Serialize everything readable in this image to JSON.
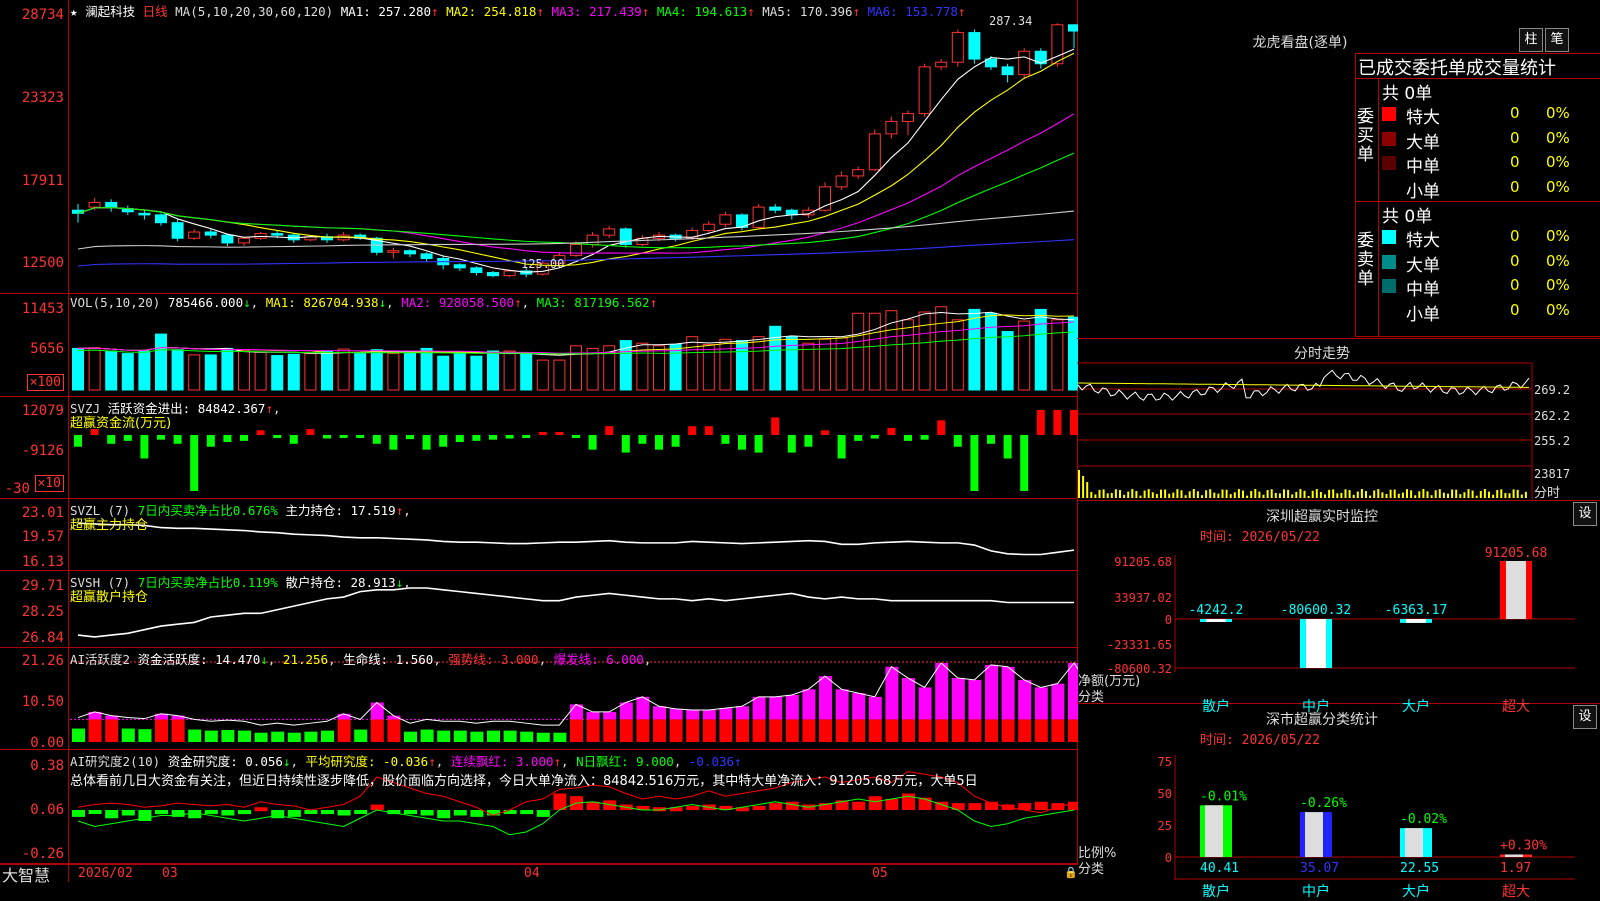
{
  "stock": {
    "name": "澜起科技",
    "period": "日线"
  },
  "kline": {
    "header": {
      "ma_params": "MA(5,10,20,30,60,120)",
      "ma1": "MA1: 257.280",
      "ma2": "MA2: 254.818",
      "ma3": "MA3: 217.439",
      "ma4": "MA4: 194.613",
      "ma5": "MA5: 170.396",
      "ma6": "MA6: 153.778"
    },
    "yaxis": [
      "28734",
      "23323",
      "17911",
      "12500"
    ],
    "high_mark": "287.34",
    "low_mark": "125.00",
    "candles": [
      [
        168,
        166,
        172,
        160
      ],
      [
        170,
        173,
        176,
        168
      ],
      [
        173,
        170,
        175,
        167
      ],
      [
        169,
        167,
        171,
        165
      ],
      [
        166,
        165,
        168,
        162
      ],
      [
        165,
        160,
        166,
        158
      ],
      [
        160,
        150,
        162,
        148
      ],
      [
        150,
        154,
        156,
        149
      ],
      [
        154,
        152,
        156,
        150
      ],
      [
        152,
        147,
        153,
        145
      ],
      [
        147,
        150,
        151,
        145
      ],
      [
        150,
        153,
        154,
        149
      ],
      [
        153,
        152,
        155,
        150
      ],
      [
        152,
        149,
        153,
        147
      ],
      [
        149,
        151,
        152,
        148
      ],
      [
        151,
        149,
        153,
        147
      ],
      [
        149,
        152,
        154,
        148
      ],
      [
        152,
        150,
        153,
        149
      ],
      [
        150,
        141,
        151,
        139
      ],
      [
        141,
        142,
        144,
        137
      ],
      [
        142,
        140,
        143,
        138
      ],
      [
        140,
        137,
        141,
        135
      ],
      [
        137,
        133,
        139,
        130
      ],
      [
        133,
        131,
        134,
        129
      ],
      [
        131,
        128,
        132,
        126
      ],
      [
        128,
        126,
        129,
        125
      ],
      [
        126,
        129,
        130,
        125
      ],
      [
        129,
        127,
        131,
        125
      ],
      [
        127,
        134,
        136,
        126
      ],
      [
        134,
        139,
        141,
        132
      ],
      [
        139,
        146,
        148,
        138
      ],
      [
        146,
        152,
        154,
        144
      ],
      [
        152,
        156,
        158,
        150
      ],
      [
        156,
        146,
        157,
        144
      ],
      [
        146,
        150,
        152,
        145
      ],
      [
        150,
        152,
        154,
        148
      ],
      [
        152,
        150,
        153,
        148
      ],
      [
        150,
        155,
        157,
        149
      ],
      [
        155,
        159,
        161,
        153
      ],
      [
        159,
        165,
        167,
        157
      ],
      [
        165,
        157,
        166,
        155
      ],
      [
        157,
        170,
        172,
        156
      ],
      [
        170,
        168,
        172,
        166
      ],
      [
        168,
        165,
        169,
        162
      ],
      [
        165,
        168,
        170,
        163
      ],
      [
        168,
        183,
        186,
        167
      ],
      [
        183,
        190,
        193,
        181
      ],
      [
        190,
        194,
        196,
        188
      ],
      [
        194,
        217,
        220,
        193
      ],
      [
        217,
        225,
        228,
        214
      ],
      [
        225,
        230,
        232,
        216
      ],
      [
        230,
        260,
        262,
        228
      ],
      [
        260,
        263,
        265,
        258
      ],
      [
        263,
        282,
        284,
        260
      ],
      [
        282,
        265,
        284,
        262
      ],
      [
        265,
        260,
        267,
        258
      ],
      [
        260,
        255,
        262,
        250
      ],
      [
        255,
        270,
        272,
        252
      ],
      [
        270,
        262,
        272,
        259
      ],
      [
        262,
        287,
        288,
        260
      ],
      [
        287,
        283,
        287,
        272
      ]
    ]
  },
  "vol": {
    "header": {
      "params": "VOL(5,10,20)",
      "value": "785466.000",
      "ma1": "MA1: 826704.938",
      "ma2": "MA2: 928058.500",
      "ma3": "MA3: 817196.562"
    },
    "yaxis": [
      "11453",
      "5656",
      "×100"
    ],
    "values": [
      640,
      650,
      600,
      560,
      600,
      860,
      620,
      540,
      540,
      640,
      610,
      580,
      530,
      550,
      560,
      600,
      630,
      560,
      620,
      560,
      600,
      640,
      520,
      560,
      520,
      600,
      600,
      550,
      460,
      460,
      680,
      640,
      680,
      760,
      720,
      680,
      700,
      820,
      700,
      780,
      760,
      820,
      980,
      820,
      720,
      780,
      800,
      1180,
      1180,
      1220,
      1080,
      1200,
      1280,
      1080,
      1240,
      1180,
      900,
      1060,
      1240,
      1080,
      1120
    ]
  },
  "svzj": {
    "header": {
      "name": "SVZJ",
      "title": "活跃资金进出: 84842.367",
      "subtitle": "超赢资金流(万元)"
    },
    "yaxis": [
      "12079",
      "-9126",
      "-30",
      "×10"
    ],
    "values": [
      -2000,
      1000,
      -1500,
      -1000,
      -4000,
      -800,
      -1500,
      -12000,
      -2000,
      -1200,
      -1000,
      800,
      -500,
      -1500,
      1000,
      -600,
      -500,
      -500,
      -1500,
      -2500,
      -700,
      -2500,
      -2000,
      -1200,
      -1000,
      -800,
      -600,
      -500,
      300,
      500,
      -300,
      -2500,
      1500,
      -3000,
      -1500,
      -2500,
      -2000,
      1500,
      1500,
      -1500,
      -2500,
      -3000,
      3000,
      -3000,
      -2000,
      800,
      -4000,
      -1000,
      -600,
      1200,
      -1000,
      -800,
      2500,
      -2000,
      -30000,
      -1500,
      -4000,
      -10000,
      5000,
      5000,
      5000
    ]
  },
  "svzl": {
    "header": {
      "name": "SVZL (7)",
      "info": "7日内买卖净占比0.676%",
      "title": "主力持仓: 17.519",
      "subtitle": "超赢主力持仓"
    },
    "yaxis": [
      "23.01",
      "19.57",
      "16.13"
    ],
    "values": [
      21.6,
      21.5,
      21.4,
      21.4,
      21.3,
      21.0,
      20.9,
      20.9,
      20.8,
      20.7,
      20.6,
      20.4,
      20.3,
      20.1,
      20.0,
      19.9,
      19.7,
      19.6,
      19.6,
      19.5,
      19.4,
      19.3,
      19.1,
      19.0,
      19.0,
      18.9,
      18.8,
      18.8,
      18.9,
      19.0,
      19.0,
      19.1,
      19.2,
      19.0,
      18.9,
      18.9,
      18.9,
      19.1,
      19.0,
      18.9,
      18.8,
      18.9,
      19.0,
      19.1,
      19.2,
      19.1,
      18.7,
      18.7,
      18.9,
      19.0,
      19.1,
      19.0,
      18.9,
      18.9,
      18.6,
      17.8,
      17.4,
      17.3,
      17.3,
      17.6,
      17.9
    ]
  },
  "svsh": {
    "header": {
      "name": "SVSH (7)",
      "info": "7日内买卖净占比0.119%",
      "title": "散户持仓: 28.913",
      "subtitle": "超赢散户持仓"
    },
    "yaxis": [
      "29.71",
      "28.25",
      "26.84"
    ],
    "values": [
      27.0,
      26.9,
      27.0,
      27.1,
      27.3,
      27.5,
      27.6,
      27.7,
      28.0,
      28.1,
      28.2,
      28.2,
      28.4,
      28.6,
      28.8,
      29.0,
      29.1,
      29.4,
      29.5,
      29.5,
      29.6,
      29.6,
      29.5,
      29.4,
      29.3,
      29.2,
      29.1,
      29.0,
      28.9,
      28.9,
      29.1,
      29.2,
      29.3,
      29.2,
      29.1,
      29.0,
      29.0,
      28.9,
      29.0,
      28.9,
      29.0,
      29.1,
      29.2,
      29.3,
      29.1,
      29.0,
      29.1,
      29.0,
      29.0,
      28.9,
      28.9,
      28.9,
      28.9,
      28.9,
      28.9,
      28.9,
      28.8,
      28.8,
      28.8,
      28.8,
      28.8
    ]
  },
  "ai_active": {
    "header": {
      "name": "AI活跃度2",
      "title": "资金活跃度: 14.470",
      "v2": "21.256",
      "life": "生命线: 1.560",
      "strong": "强势线: 3.000",
      "burst": "爆发线: 6.000"
    },
    "yaxis": [
      "21.26",
      "10.50",
      "0.00"
    ],
    "values": [
      6.5,
      8,
      7,
      6.5,
      6.2,
      7.5,
      7,
      6,
      5.5,
      5.8,
      5.5,
      4.5,
      5,
      4.5,
      5,
      5.5,
      7.5,
      6,
      10.5,
      7,
      5,
      6,
      5.5,
      5.5,
      5,
      5.5,
      5.5,
      5,
      4.5,
      4.5,
      10,
      8,
      8,
      10.5,
      12,
      9.5,
      8.8,
      8.5,
      8.5,
      9,
      9.5,
      12,
      12,
      12.5,
      14,
      17.5,
      14,
      13,
      12,
      20,
      17,
      14.5,
      21,
      17,
      16.5,
      20.5,
      20,
      16.5,
      14.5,
      15.5,
      21,
      14.5
    ]
  },
  "ai_research": {
    "header": {
      "name": "AI研究度2(10)",
      "title": "资金研究度: 0.056",
      "avg": "平均研究度: -0.036",
      "red": "连续飘红: 3.000",
      "nred": "N日飘红: 9.000",
      "last": "-0.036"
    },
    "yaxis": [
      "0.38",
      "0.06",
      "-0.26"
    ],
    "summary": "总体看前几日大资金有关注，但近日持续性逐步降低，股价面临方向选择，今日大单净流入：84842.516万元，其中特大单净流入：91205.68万元，大单5日",
    "values": [
      -0.05,
      -0.02,
      -0.06,
      -0.04,
      -0.08,
      -0.03,
      -0.05,
      -0.06,
      -0.03,
      -0.04,
      -0.03,
      0.02,
      -0.06,
      -0.05,
      -0.02,
      -0.03,
      -0.04,
      -0.02,
      0.04,
      -0.03,
      -0.03,
      -0.04,
      -0.06,
      -0.04,
      -0.05,
      -0.04,
      -0.02,
      -0.03,
      -0.05,
      0.12,
      0.1,
      0.06,
      0.07,
      0.04,
      0.03,
      0.02,
      0.02,
      0.03,
      0.04,
      0.03,
      0.02,
      0.03,
      0.05,
      0.06,
      0.04,
      0.05,
      0.07,
      0.06,
      0.1,
      0.08,
      0.12,
      0.09,
      0.06,
      0.05,
      0.05,
      0.06,
      0.04,
      0.05,
      0.06,
      0.05,
      0.06
    ],
    "line1": [
      0.02,
      0.04,
      0.05,
      0.04,
      0.02,
      0.03,
      0.05,
      0.04,
      0.03,
      0.04,
      0.02,
      0.06,
      0.04,
      0.03,
      0.0,
      0.02,
      0.04,
      0.1,
      0.24,
      0.2,
      0.16,
      0.12,
      0.1,
      0.06,
      0.02,
      -0.04,
      0.0,
      0.06,
      0.08,
      0.15,
      0.16,
      0.18,
      0.17,
      0.12,
      0.08,
      0.1,
      0.08,
      0.1,
      0.14,
      0.1,
      0.12,
      0.14,
      0.16,
      0.2,
      0.22,
      0.24,
      0.2,
      0.22,
      0.24,
      0.2,
      0.28,
      0.26,
      0.24,
      0.2,
      0.1,
      0.05,
      0.02,
      0.0,
      -0.02,
      0.02,
      0.05
    ],
    "line2": [
      -0.08,
      -0.12,
      -0.1,
      -0.08,
      -0.06,
      -0.04,
      -0.04,
      -0.02,
      -0.04,
      -0.06,
      -0.08,
      -0.06,
      -0.04,
      -0.06,
      -0.08,
      -0.1,
      -0.12,
      -0.06,
      0.0,
      -0.02,
      -0.04,
      -0.06,
      -0.08,
      -0.08,
      -0.1,
      -0.12,
      -0.18,
      -0.16,
      -0.1,
      0.0,
      0.05,
      0.06,
      0.04,
      0.02,
      0.0,
      0.0,
      0.02,
      0.04,
      0.02,
      0.0,
      0.02,
      0.04,
      0.06,
      0.04,
      0.02,
      0.04,
      0.06,
      0.08,
      0.06,
      0.08,
      0.1,
      0.08,
      0.04,
      0.0,
      -0.08,
      -0.12,
      -0.1,
      -0.06,
      -0.04,
      -0.02,
      0.0
    ]
  },
  "xaxis": {
    "labels": [
      "2026/02",
      "03",
      "04",
      "05"
    ],
    "brand": "大智慧"
  },
  "dragon_tiger": {
    "title": "龙虎看盘(逐单)",
    "btn_bar": "柱",
    "btn_pen": "笔",
    "table_header": "已成交委托单成交量统计",
    "buy": {
      "side": "委买单",
      "total": "共 0单",
      "rows": [
        {
          "name": "特大",
          "n": "0",
          "pct": "0%",
          "color": "#ff0000"
        },
        {
          "name": "大单",
          "n": "0",
          "pct": "0%",
          "color": "#8b0000"
        },
        {
          "name": "中单",
          "n": "0",
          "pct": "0%",
          "color": "#5a0000"
        },
        {
          "name": "小单",
          "n": "0",
          "pct": "0%",
          "color": ""
        }
      ]
    },
    "sell": {
      "side": "委卖单",
      "total": "共 0单",
      "rows": [
        {
          "name": "特大",
          "n": "0",
          "pct": "0%",
          "color": "#00ffff"
        },
        {
          "name": "大单",
          "n": "0",
          "pct": "0%",
          "color": "#008b8b"
        },
        {
          "name": "中单",
          "n": "0",
          "pct": "0%",
          "color": "#006b6b"
        },
        {
          "name": "小单",
          "n": "0",
          "pct": "0%",
          "color": ""
        }
      ]
    }
  },
  "intraday": {
    "title": "分时走势",
    "yaxis": [
      "269.2",
      "262.2",
      "255.2",
      "23817"
    ],
    "unit": "分时"
  },
  "sz_monitor": {
    "title": "深圳超赢实时监控",
    "btn": "设",
    "time": "时间: 2026/05/22",
    "yaxis": [
      "91205.68",
      "33937.02",
      "0",
      "-23331.65",
      "-80600.32"
    ],
    "ylabel1": "净额(万元)",
    "ylabel2": "分类",
    "bars": [
      {
        "cat": "散户",
        "value": -4242.2,
        "label": "-4242.2"
      },
      {
        "cat": "中户",
        "value": -80600.32,
        "label": "-80600.32"
      },
      {
        "cat": "大户",
        "value": -6363.17,
        "label": "-6363.17"
      },
      {
        "cat": "超大",
        "value": 91205.68,
        "label": "91205.68"
      }
    ]
  },
  "sz_stats": {
    "title": "深市超赢分类统计",
    "btn": "设",
    "time": "时间: 2026/05/22",
    "yaxis": [
      "75",
      "50",
      "25",
      "0"
    ],
    "ylabel1": "比例%",
    "ylabel2": "分类",
    "bars": [
      {
        "cat": "散户",
        "value": 40.41,
        "change": "-0.01%",
        "color": "#00ff00"
      },
      {
        "cat": "中户",
        "value": 35.07,
        "change": "-0.26%",
        "color": "#2222ff"
      },
      {
        "cat": "大户",
        "value": 22.55,
        "change": "-0.02%",
        "color": "#00ffff"
      },
      {
        "cat": "超大",
        "value": 1.97,
        "change": "+0.30%",
        "color": "#ff2222"
      }
    ]
  }
}
